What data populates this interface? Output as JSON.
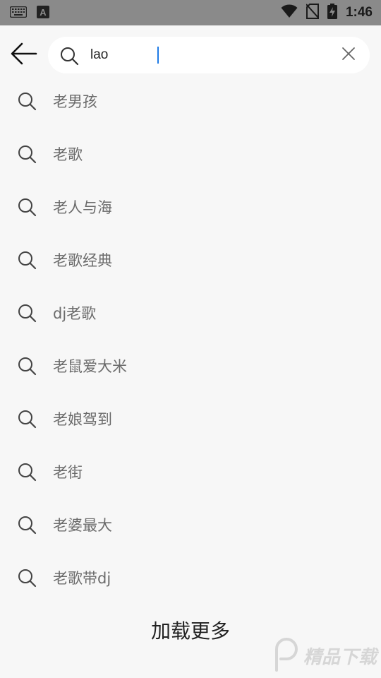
{
  "status_bar": {
    "time": "1:46",
    "left_icons": [
      "keyboard-icon",
      "font-a-icon"
    ],
    "right_icons": [
      "wifi-icon",
      "no-sim-icon",
      "battery-charging-icon"
    ],
    "a_glyph": "A"
  },
  "search": {
    "value": "lao",
    "back_icon": "arrow-left-icon",
    "clear_icon": "close-icon"
  },
  "suggestions": [
    {
      "label": "老男孩"
    },
    {
      "label": "老歌"
    },
    {
      "label": "老人与海"
    },
    {
      "label": "老歌经典"
    },
    {
      "label": "dj老歌"
    },
    {
      "label": "老鼠爱大米"
    },
    {
      "label": "老娘驾到"
    },
    {
      "label": "老街"
    },
    {
      "label": "老婆最大"
    },
    {
      "label": "老歌带dj"
    }
  ],
  "load_more": "加载更多",
  "watermark": {
    "text": "精品下载"
  },
  "colors": {
    "status_bar_bg": "#8a8a8a",
    "page_bg": "#f7f7f7",
    "caret": "#1e7be6",
    "suggestion_text": "#6b6b6b"
  }
}
